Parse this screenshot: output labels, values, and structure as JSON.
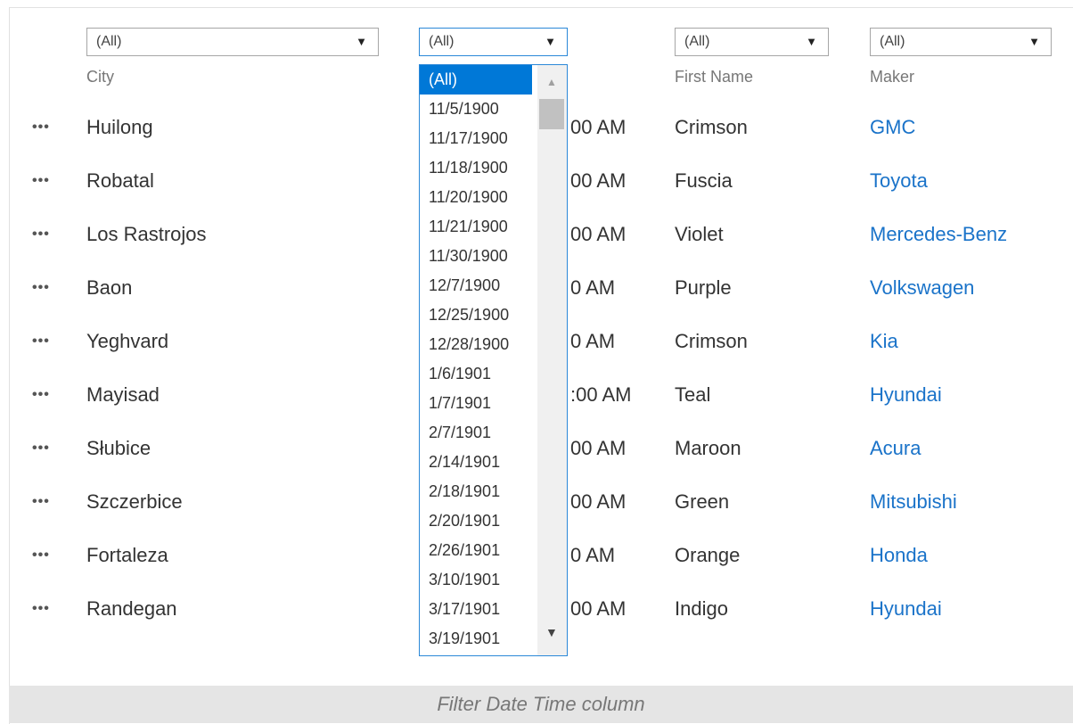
{
  "filters": {
    "city": {
      "value": "(All)",
      "label": "City"
    },
    "datetime": {
      "value": "(All)"
    },
    "firstname": {
      "value": "(All)",
      "label": "First Name"
    },
    "maker": {
      "value": "(All)",
      "label": "Maker"
    }
  },
  "row_menu_icon": "ellipsis-icon",
  "dropdown_options": [
    "(All)",
    "11/5/1900",
    "11/17/1900",
    "11/18/1900",
    "11/20/1900",
    "11/21/1900",
    "11/30/1900",
    "12/7/1900",
    "12/25/1900",
    "12/28/1900",
    "1/6/1901",
    "1/7/1901",
    "2/7/1901",
    "2/14/1901",
    "2/18/1901",
    "2/20/1901",
    "2/26/1901",
    "3/10/1901",
    "3/17/1901",
    "3/19/1901"
  ],
  "rows": [
    {
      "city": "Huilong",
      "time": "00 AM",
      "first": "Crimson",
      "maker": "GMC"
    },
    {
      "city": "Robatal",
      "time": "00 AM",
      "first": "Fuscia",
      "maker": "Toyota"
    },
    {
      "city": "Los Rastrojos",
      "time": "00 AM",
      "first": "Violet",
      "maker": "Mercedes-Benz"
    },
    {
      "city": "Baon",
      "time": "0 AM",
      "first": "Purple",
      "maker": "Volkswagen"
    },
    {
      "city": "Yeghvard",
      "time": "0 AM",
      "first": "Crimson",
      "maker": "Kia"
    },
    {
      "city": "Mayisad",
      "time": ":00 AM",
      "first": "Teal",
      "maker": "Hyundai"
    },
    {
      "city": "Słubice",
      "time": "00 AM",
      "first": "Maroon",
      "maker": "Acura"
    },
    {
      "city": "Szczerbice",
      "time": "00 AM",
      "first": "Green",
      "maker": "Mitsubishi"
    },
    {
      "city": "Fortaleza",
      "time": "0 AM",
      "first": "Orange",
      "maker": "Honda"
    },
    {
      "city": "Randegan",
      "time": "00 AM",
      "first": "Indigo",
      "maker": "Hyundai"
    }
  ],
  "caption": "Filter Date Time column",
  "colors": {
    "link": "#1a73c9",
    "selected": "#0078d7",
    "active_border": "#2b88d8"
  }
}
